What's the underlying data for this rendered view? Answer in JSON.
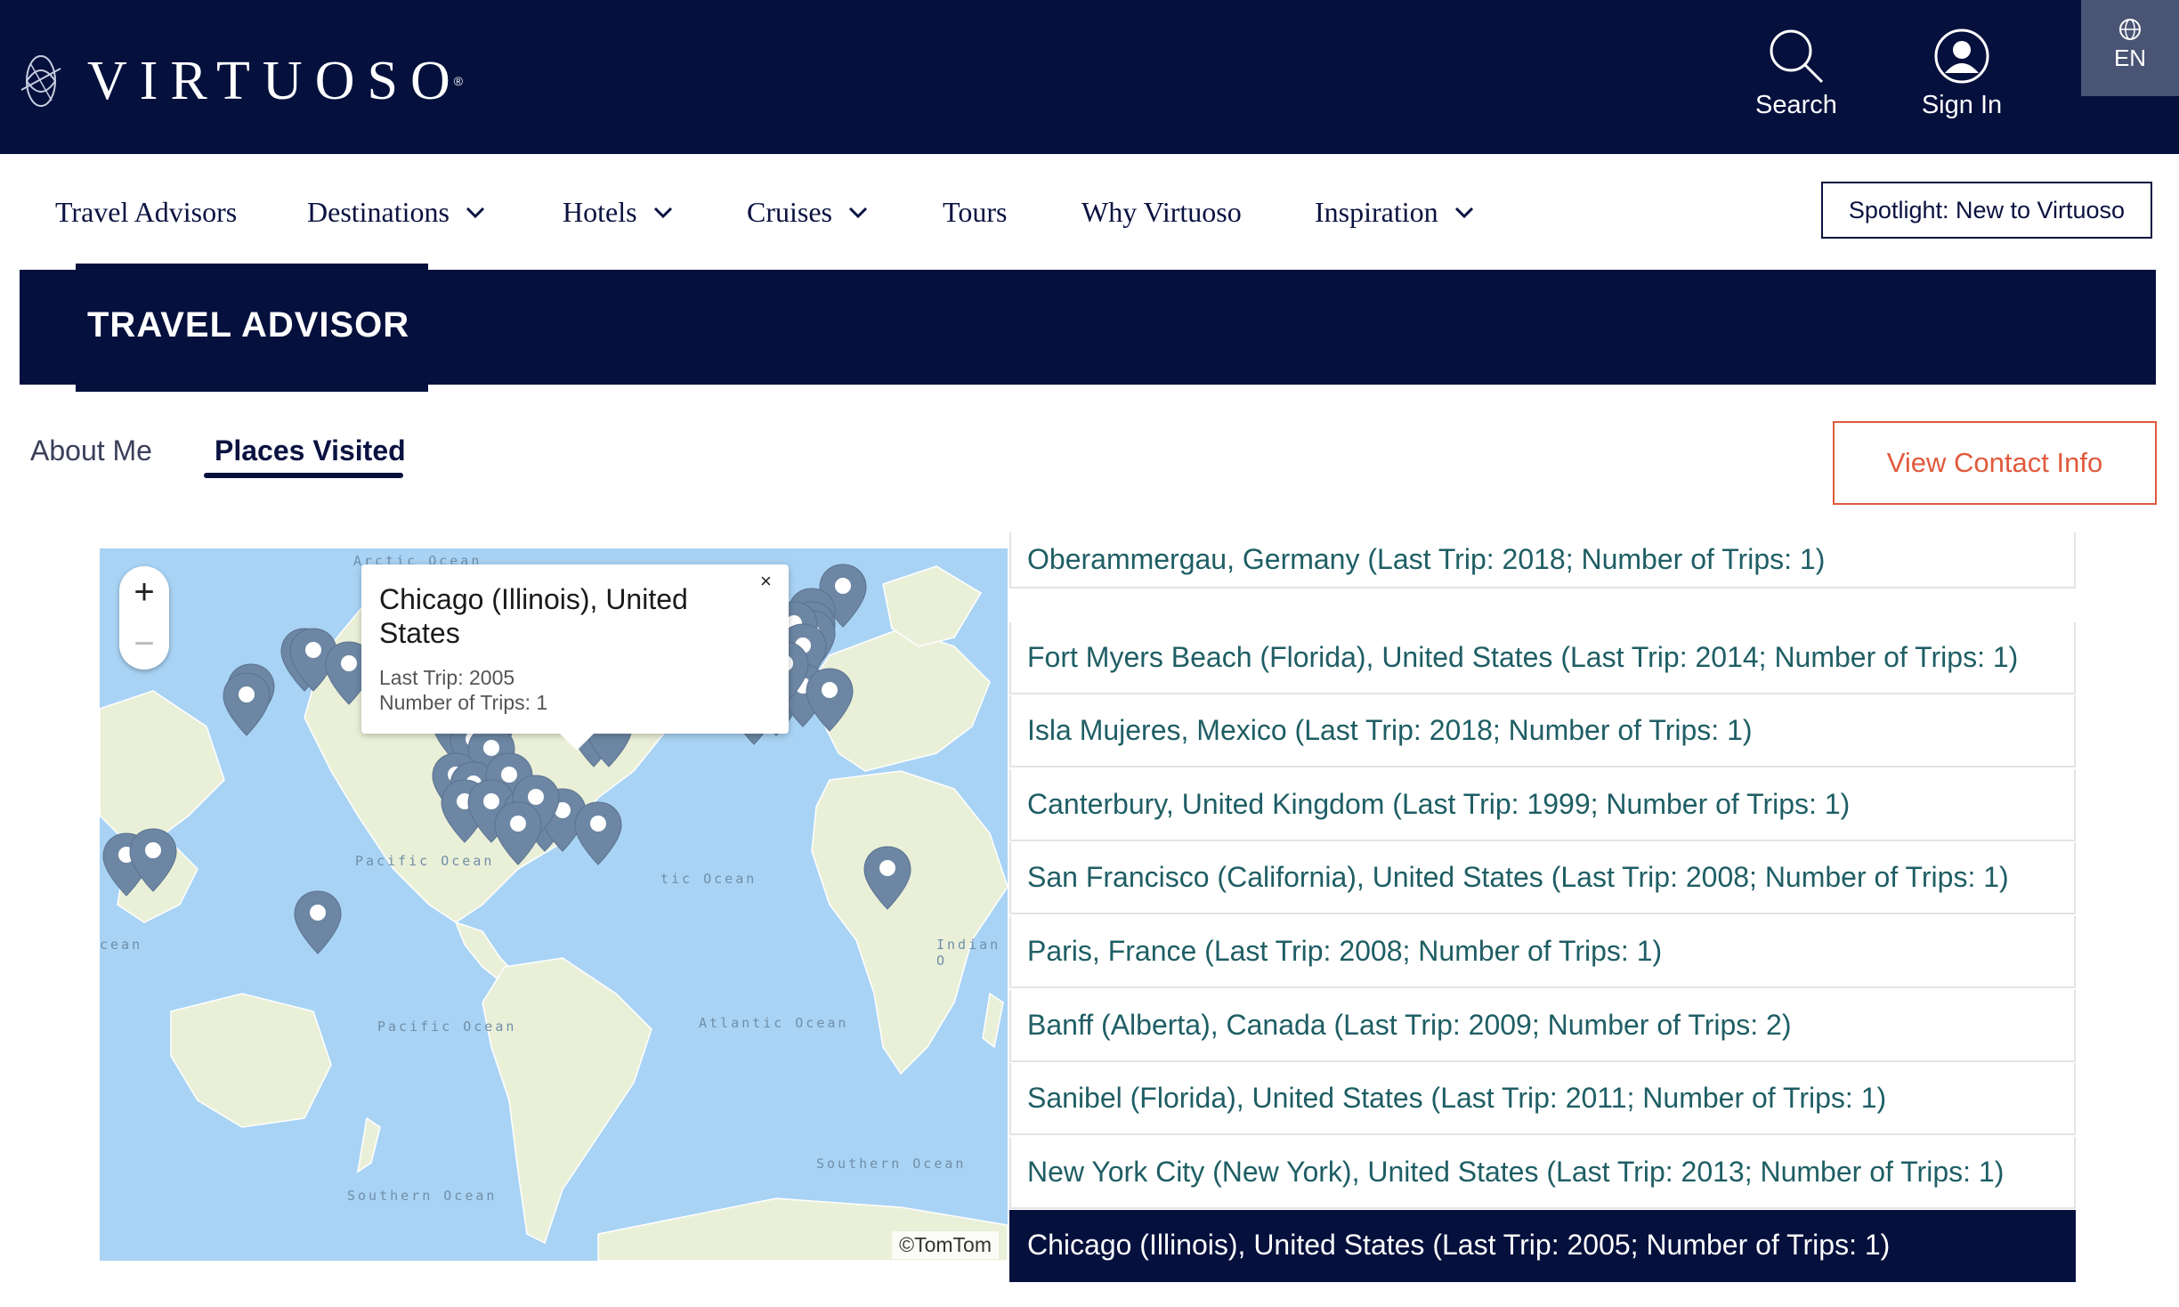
{
  "header": {
    "brand": "VIRTUOSO",
    "search_label": "Search",
    "signin_label": "Sign In",
    "lang_label": "EN"
  },
  "nav": {
    "items": [
      {
        "label": "Travel Advisors",
        "dropdown": false
      },
      {
        "label": "Destinations",
        "dropdown": true
      },
      {
        "label": "Hotels",
        "dropdown": true
      },
      {
        "label": "Cruises",
        "dropdown": true
      },
      {
        "label": "Tours",
        "dropdown": false
      },
      {
        "label": "Why Virtuoso",
        "dropdown": false
      },
      {
        "label": "Inspiration",
        "dropdown": true
      }
    ],
    "spotlight_label": "Spotlight: New to Virtuoso"
  },
  "banner": {
    "title": "TRAVEL ADVISOR"
  },
  "tabs": {
    "about": "About Me",
    "places": "Places Visited",
    "active": "places"
  },
  "contact_button": "View Contact Info",
  "map": {
    "zoom_in": "+",
    "zoom_out": "−",
    "attribution": "©TomTom",
    "ocean_labels": [
      "Arctic Ocean",
      "Pacific Ocean",
      "Pacific Ocean",
      "Atlantic Ocean",
      "Indian O",
      "Southern Ocean",
      "Southern Ocean",
      "tic Ocean",
      "cean"
    ],
    "popup": {
      "title": "Chicago (Illinois), United States",
      "last_trip": "Last Trip: 2005",
      "trips": "Number of Trips: 1",
      "close": "×"
    },
    "colors": {
      "water": "#a9d3f4",
      "land": "#eaf0d8",
      "marker": "#6c86a3"
    }
  },
  "places": [
    "Oberammergau, Germany (Last Trip: 2018; Number of Trips: 1)",
    "Fort Myers Beach (Florida), United States (Last Trip: 2014; Number of Trips: 1)",
    "Isla Mujeres, Mexico (Last Trip: 2018; Number of Trips: 1)",
    "Canterbury, United Kingdom (Last Trip: 1999; Number of Trips: 1)",
    "San Francisco (California), United States (Last Trip: 2008; Number of Trips: 1)",
    "Paris, France (Last Trip: 2008; Number of Trips: 1)",
    "Banff (Alberta), Canada (Last Trip: 2009; Number of Trips: 2)",
    "Sanibel (Florida), United States (Last Trip: 2011; Number of Trips: 1)",
    "New York City (New York), United States (Last Trip: 2013; Number of Trips: 1)",
    "Chicago (Illinois), United States (Last Trip: 2005; Number of Trips: 1)"
  ],
  "active_place_index": 9,
  "colors": {
    "navy": "#05103d",
    "accent": "#e05a3c",
    "link": "#1e5e64"
  }
}
